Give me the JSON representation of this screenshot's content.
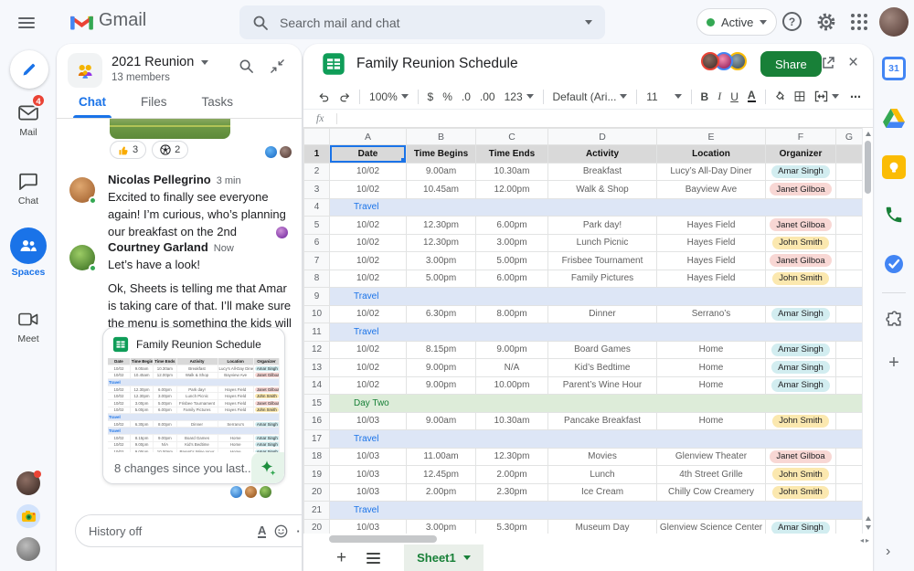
{
  "topbar": {
    "app": "Gmail",
    "search_placeholder": "Search mail and chat",
    "status_label": "Active",
    "help_label": "?"
  },
  "left_rail": {
    "mail_label": "Mail",
    "mail_badge": "4",
    "chat_label": "Chat",
    "spaces_label": "Spaces",
    "meet_label": "Meet"
  },
  "chat": {
    "space_name": "2021 Reunion",
    "members": "13 members",
    "tabs": {
      "chat": "Chat",
      "files": "Files",
      "tasks": "Tasks"
    },
    "reactions": {
      "thumbs_count": "3",
      "ball_count": "2"
    },
    "messages": [
      {
        "sender": "Nicolas Pellegrino",
        "time": "3 min",
        "text": "Excited to finally see everyone again! I’m curious, who’s planning our breakfast on the 2nd"
      },
      {
        "sender": "Courtney Garland",
        "time": "Now",
        "text": "Let’s have a look!",
        "text2": "Ok, Sheets is telling me that Amar is taking care of that. I’ll make sure the menu is something the kids will like!"
      }
    ],
    "doc_card": {
      "title": "Family Reunion Schedule",
      "footer": "8 changes since you last..."
    },
    "compose": {
      "placeholder": "History off"
    }
  },
  "sheet": {
    "title": "Family Reunion Schedule",
    "share_label": "Share",
    "toolbar": {
      "zoom": "100%",
      "currency": "$",
      "percent": "%",
      "dec0": ".0",
      "dec00": ".00",
      "numfmt": "123",
      "font": "Default (Ari...",
      "size": "11",
      "bold": "B",
      "italic": "I",
      "underline": "U",
      "textcolor": "A",
      "more": "⋯"
    },
    "formula_label": "fx",
    "columns": [
      "A",
      "B",
      "C",
      "D",
      "E",
      "F",
      "G"
    ],
    "grid": {
      "headers": [
        "Date",
        "Time Begins",
        "Time Ends",
        "Activity",
        "Location",
        "Organizer"
      ],
      "rows": [
        {
          "n": "2",
          "date": "10/02",
          "begins": "9.00am",
          "ends": "10.30am",
          "activity": "Breakfast",
          "location": "Lucy’s All-Day Diner",
          "organizer": "Amar Singh",
          "org": "cyan"
        },
        {
          "n": "3",
          "date": "10/02",
          "begins": "10.45am",
          "ends": "12.00pm",
          "activity": "Walk & Shop",
          "location": "Bayview Ave",
          "organizer": "Janet Gilboa",
          "org": "pink"
        },
        {
          "n": "4",
          "type": "travel",
          "label": "Travel"
        },
        {
          "n": "5",
          "date": "10/02",
          "begins": "12.30pm",
          "ends": "6.00pm",
          "activity": "Park day!",
          "location": "Hayes Field",
          "organizer": "Janet Gilboa",
          "org": "pink"
        },
        {
          "n": "6",
          "date": "10/02",
          "begins": "12.30pm",
          "ends": "3.00pm",
          "activity": "Lunch Picnic",
          "location": "Hayes Field",
          "organizer": "John Smith",
          "org": "yellow"
        },
        {
          "n": "7",
          "date": "10/02",
          "begins": "3.00pm",
          "ends": "5.00pm",
          "activity": "Frisbee Tournament",
          "location": "Hayes Field",
          "organizer": "Janet Gilboa",
          "org": "pink"
        },
        {
          "n": "8",
          "date": "10/02",
          "begins": "5.00pm",
          "ends": "6.00pm",
          "activity": "Family Pictures",
          "location": "Hayes Field",
          "organizer": "John Smith",
          "org": "yellow"
        },
        {
          "n": "9",
          "type": "travel",
          "label": "Travel"
        },
        {
          "n": "10",
          "date": "10/02",
          "begins": "6.30pm",
          "ends": "8.00pm",
          "activity": "Dinner",
          "location": "Serrano’s",
          "organizer": "Amar Singh",
          "org": "cyan"
        },
        {
          "n": "11",
          "type": "travel",
          "label": "Travel"
        },
        {
          "n": "12",
          "date": "10/02",
          "begins": "8.15pm",
          "ends": "9.00pm",
          "activity": "Board Games",
          "location": "Home",
          "organizer": "Amar Singh",
          "org": "cyan"
        },
        {
          "n": "13",
          "date": "10/02",
          "begins": "9.00pm",
          "ends": "N/A",
          "activity": "Kid’s Bedtime",
          "location": "Home",
          "organizer": "Amar Singh",
          "org": "cyan"
        },
        {
          "n": "14",
          "date": "10/02",
          "begins": "9.00pm",
          "ends": "10.00pm",
          "activity": "Parent’s Wine Hour",
          "location": "Home",
          "organizer": "Amar Singh",
          "org": "cyan"
        },
        {
          "n": "15",
          "type": "daytwo",
          "label": "Day Two"
        },
        {
          "n": "16",
          "date": "10/03",
          "begins": "9.00am",
          "ends": "10.30am",
          "activity": "Pancake Breakfast",
          "location": "Home",
          "organizer": "John Smith",
          "org": "yellow"
        },
        {
          "n": "17",
          "type": "travel",
          "label": "Travel"
        },
        {
          "n": "18",
          "date": "10/03",
          "begins": "11.00am",
          "ends": "12.30pm",
          "activity": "Movies",
          "location": "Glenview Theater",
          "organizer": "Janet Gilboa",
          "org": "pink"
        },
        {
          "n": "19",
          "date": "10/03",
          "begins": "12.45pm",
          "ends": "2.00pm",
          "activity": "Lunch",
          "location": "4th Street Grille",
          "organizer": "John Smith",
          "org": "yellow"
        },
        {
          "n": "20",
          "date": "10/03",
          "begins": "2.00pm",
          "ends": "2.30pm",
          "activity": "Ice Cream",
          "location": "Chilly Cow Creamery",
          "organizer": "John Smith",
          "org": "yellow"
        },
        {
          "n": "21",
          "type": "travel",
          "label": "Travel"
        },
        {
          "n": "20",
          "partial": true,
          "date": "10/03",
          "begins": "3.00pm",
          "ends": "5.30pm",
          "activity": "Museum Day",
          "location": "Glenview Science Center",
          "organizer": "Amar Singh",
          "org": "cyan"
        }
      ]
    },
    "footer": {
      "tab_name": "Sheet1"
    }
  },
  "right_rail": {
    "calendar_label": "31"
  },
  "colors": {
    "accent_blue": "#1a73e8",
    "share_green": "#188038",
    "travel_bg": "#dde6f6",
    "daytwo_bg": "#ddecd9",
    "pill_cyan": "#d2edf0",
    "pill_pink": "#f8d7d4",
    "pill_yellow": "#fbe8af",
    "badge_red": "#ea4335"
  }
}
